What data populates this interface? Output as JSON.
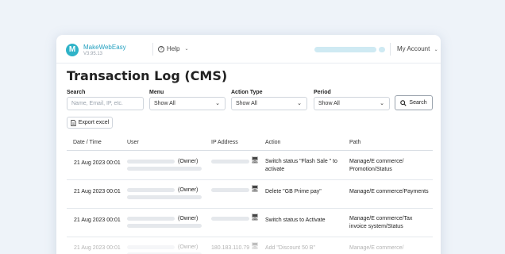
{
  "header": {
    "logo_letter": "M",
    "brand": "MakeWebEasy",
    "version": "V3.95.13",
    "help_label": "Help",
    "help_glyph": "?",
    "account_label": "My Account",
    "chevron": "⌄"
  },
  "page": {
    "title": "Transaction Log (CMS)"
  },
  "filters": {
    "search_label": "Search",
    "search_placeholder": "Name, Email, IP, etc.",
    "menu_label": "Menu",
    "menu_value": "Show All",
    "action_type_label": "Action Type",
    "action_type_value": "Show All",
    "period_label": "Period",
    "period_value": "Show All",
    "dropdown_glyph": "⌄",
    "search_button": "Search",
    "export_button": "Export excel"
  },
  "table": {
    "headers": [
      "Date / Time",
      "User",
      "IP Address",
      "Action",
      "Path"
    ],
    "rows": [
      {
        "date": "21 Aug 2023 00:01",
        "role": "(Owner)",
        "ip": "",
        "action": [
          "Switch status \"Flash Sale \" to",
          "activate"
        ],
        "path": [
          "Manage/E commerce/",
          "Promotion/Status"
        ]
      },
      {
        "date": "21 Aug 2023 00:01",
        "role": "(Owner)",
        "ip": "",
        "action": [
          "Delete \"GB Prime pay\"",
          ""
        ],
        "path": [
          "Manage/E commerce/Payments",
          ""
        ]
      },
      {
        "date": "21 Aug 2023 00:01",
        "role": "(Owner)",
        "ip": "",
        "action": [
          "Switch status to Activate",
          ""
        ],
        "path": [
          "Manage/E commerce/Tax",
          "invoice system/Status"
        ]
      },
      {
        "date": "21 Aug 2023 00:01",
        "role": "(Owner)",
        "ip": "180.183.110.79",
        "action": [
          "Add \"Discount 50 B\"",
          ""
        ],
        "path": [
          "Manage/E commerce/",
          ""
        ]
      }
    ]
  },
  "colors": {
    "accent": "#2fb3c8",
    "background": "#eef3f9"
  }
}
